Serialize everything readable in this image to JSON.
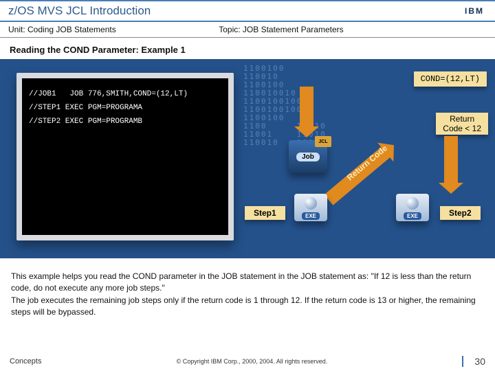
{
  "header": {
    "title": "z/OS MVS JCL Introduction",
    "logo_text": "IBM"
  },
  "subhead": {
    "unit": "Unit: Coding JOB Statements",
    "topic": "Topic: JOB Statement Parameters"
  },
  "section_title": "Reading the COND Parameter: Example 1",
  "terminal": {
    "line1": "//JOB1   JOB 776,SMITH,COND=(12,LT)",
    "line2": "//STEP1 EXEC PGM=PROGRAMA",
    "line3": "//STEP2 EXEC PGM=PROGRAMB"
  },
  "callouts": {
    "cond": "COND=(12,LT)",
    "return_code_l1": "Return",
    "return_code_l2": "Code < 12",
    "arrow_label": "Return Code"
  },
  "badges": {
    "jcl_corner": "JCL",
    "job_sub": "Job",
    "exe_sub": "EXE",
    "step1": "Step1",
    "step2": "Step2"
  },
  "body_text": "This example helps you read the COND parameter in the JOB statement in the JOB statement as: \"If 12 is less than the return code, do not execute any more job steps.\"\nThe job executes the remaining job steps only if the return code is 1 through 12. If the return code is 13 or higher, the remaining steps will be bypassed.",
  "footer": {
    "concepts": "Concepts",
    "copyright": "© Copyright IBM Corp., 2000, 2004. All rights reserved.",
    "page": "30"
  },
  "decor": {
    "binary": "1100100\n110010\n1100100\n110010010\n11001001001\n1100100100\n1100100\n1100     11010\n11001    11010\n110010   10100"
  }
}
